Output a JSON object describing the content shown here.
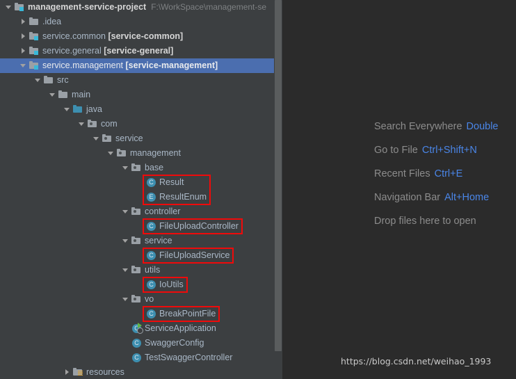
{
  "colors": {
    "tree_bg": "#3c3f41",
    "editor_bg": "#2b2b2b",
    "selection": "#4b6eaf",
    "text": "#a9b7c6",
    "dim_text": "#7e8183",
    "accent_blue": "#4a86e8",
    "highlight_red": "#f00a0a",
    "icon_teal": "#3d8fb0",
    "module_badge": "#3ab8d8",
    "run_green": "#62b543"
  },
  "project_tree": {
    "rows": [
      {
        "id": "management-service-project",
        "depth": 0,
        "arrow": "expanded",
        "icon": "module-folder-icon",
        "label": "management-service-project",
        "bold": true,
        "path": "F:\\WorkSpace\\management-se",
        "selected": false,
        "highlighted": false
      },
      {
        "id": "idea",
        "depth": 1,
        "arrow": "collapsed",
        "icon": "folder-icon",
        "label": ".idea",
        "bold": false,
        "path": "",
        "selected": false,
        "highlighted": false
      },
      {
        "id": "service-common",
        "depth": 1,
        "arrow": "collapsed",
        "icon": "module-folder-icon",
        "label": "service.common ",
        "bracket": "[service-common]",
        "bold": false,
        "path": "",
        "selected": false,
        "highlighted": false
      },
      {
        "id": "service-general",
        "depth": 1,
        "arrow": "collapsed",
        "icon": "module-folder-icon",
        "label": "service.general ",
        "bracket": "[service-general]",
        "bold": false,
        "path": "",
        "selected": false,
        "highlighted": false
      },
      {
        "id": "service-management",
        "depth": 1,
        "arrow": "expanded",
        "icon": "module-folder-icon",
        "label": "service.management ",
        "bracket": "[service-management]",
        "bold": false,
        "path": "",
        "selected": true,
        "highlighted": false
      },
      {
        "id": "src",
        "depth": 2,
        "arrow": "expanded",
        "icon": "folder-icon",
        "label": "src",
        "bold": false,
        "path": "",
        "selected": false,
        "highlighted": false
      },
      {
        "id": "main",
        "depth": 3,
        "arrow": "expanded",
        "icon": "folder-icon",
        "label": "main",
        "bold": false,
        "path": "",
        "selected": false,
        "highlighted": false
      },
      {
        "id": "java",
        "depth": 4,
        "arrow": "expanded",
        "icon": "source-root-folder-icon",
        "label": "java",
        "bold": false,
        "path": "",
        "selected": false,
        "highlighted": false
      },
      {
        "id": "com",
        "depth": 5,
        "arrow": "expanded",
        "icon": "package-icon",
        "label": "com",
        "bold": false,
        "path": "",
        "selected": false,
        "highlighted": false
      },
      {
        "id": "service",
        "depth": 6,
        "arrow": "expanded",
        "icon": "package-icon",
        "label": "service",
        "bold": false,
        "path": "",
        "selected": false,
        "highlighted": false
      },
      {
        "id": "management",
        "depth": 7,
        "arrow": "expanded",
        "icon": "package-icon",
        "label": "management",
        "bold": false,
        "path": "",
        "selected": false,
        "highlighted": false
      },
      {
        "id": "base",
        "depth": 8,
        "arrow": "expanded",
        "icon": "package-icon",
        "label": "base",
        "bold": false,
        "path": "",
        "selected": false,
        "highlighted": false
      },
      {
        "id": "Result",
        "depth": 9,
        "arrow": "none",
        "icon": "class-icon",
        "label": "Result",
        "bold": false,
        "path": "",
        "selected": false,
        "highlighted": true
      },
      {
        "id": "ResultEnum",
        "depth": 9,
        "arrow": "none",
        "icon": "enum-icon",
        "label": "ResultEnum",
        "bold": false,
        "path": "",
        "selected": false,
        "highlighted": true
      },
      {
        "id": "controller",
        "depth": 8,
        "arrow": "expanded",
        "icon": "package-icon",
        "label": "controller",
        "bold": false,
        "path": "",
        "selected": false,
        "highlighted": false
      },
      {
        "id": "FileUploadController",
        "depth": 9,
        "arrow": "none",
        "icon": "class-icon",
        "label": "FileUploadController",
        "bold": false,
        "path": "",
        "selected": false,
        "highlighted": true
      },
      {
        "id": "service-pkg",
        "depth": 8,
        "arrow": "expanded",
        "icon": "package-icon",
        "label": "service",
        "bold": false,
        "path": "",
        "selected": false,
        "highlighted": false
      },
      {
        "id": "FileUploadService",
        "depth": 9,
        "arrow": "none",
        "icon": "class-icon",
        "label": "FileUploadService",
        "bold": false,
        "path": "",
        "selected": false,
        "highlighted": true
      },
      {
        "id": "utils",
        "depth": 8,
        "arrow": "expanded",
        "icon": "package-icon",
        "label": "utils",
        "bold": false,
        "path": "",
        "selected": false,
        "highlighted": false
      },
      {
        "id": "IoUtils",
        "depth": 9,
        "arrow": "none",
        "icon": "class-icon",
        "label": "IoUtils",
        "bold": false,
        "path": "",
        "selected": false,
        "highlighted": true
      },
      {
        "id": "vo",
        "depth": 8,
        "arrow": "expanded",
        "icon": "package-icon",
        "label": "vo",
        "bold": false,
        "path": "",
        "selected": false,
        "highlighted": false
      },
      {
        "id": "BreakPointFile",
        "depth": 9,
        "arrow": "none",
        "icon": "class-icon",
        "label": "BreakPointFile",
        "bold": false,
        "path": "",
        "selected": false,
        "highlighted": true
      },
      {
        "id": "ServiceApplication",
        "depth": 8,
        "arrow": "none",
        "icon": "spring-boot-application-icon",
        "label": "ServiceApplication",
        "bold": false,
        "path": "",
        "selected": false,
        "highlighted": false
      },
      {
        "id": "SwaggerConfig",
        "depth": 8,
        "arrow": "none",
        "icon": "class-icon",
        "label": "SwaggerConfig",
        "bold": false,
        "path": "",
        "selected": false,
        "highlighted": false
      },
      {
        "id": "TestSwaggerController",
        "depth": 8,
        "arrow": "none",
        "icon": "class-icon",
        "label": "TestSwaggerController",
        "bold": false,
        "path": "",
        "selected": false,
        "highlighted": false
      },
      {
        "id": "resources",
        "depth": 4,
        "arrow": "collapsed",
        "icon": "resources-folder-icon",
        "label": "resources",
        "bold": false,
        "path": "",
        "selected": false,
        "highlighted": false
      }
    ]
  },
  "editor": {
    "shortcuts": [
      {
        "action": "Search Everywhere",
        "keys": "Double"
      },
      {
        "action": "Go to File",
        "keys": "Ctrl+Shift+N"
      },
      {
        "action": "Recent Files",
        "keys": "Ctrl+E"
      },
      {
        "action": "Navigation Bar",
        "keys": "Alt+Home"
      },
      {
        "action": "Drop files here to open",
        "keys": ""
      }
    ],
    "watermark": "https://blog.csdn.net/weihao_1993"
  }
}
